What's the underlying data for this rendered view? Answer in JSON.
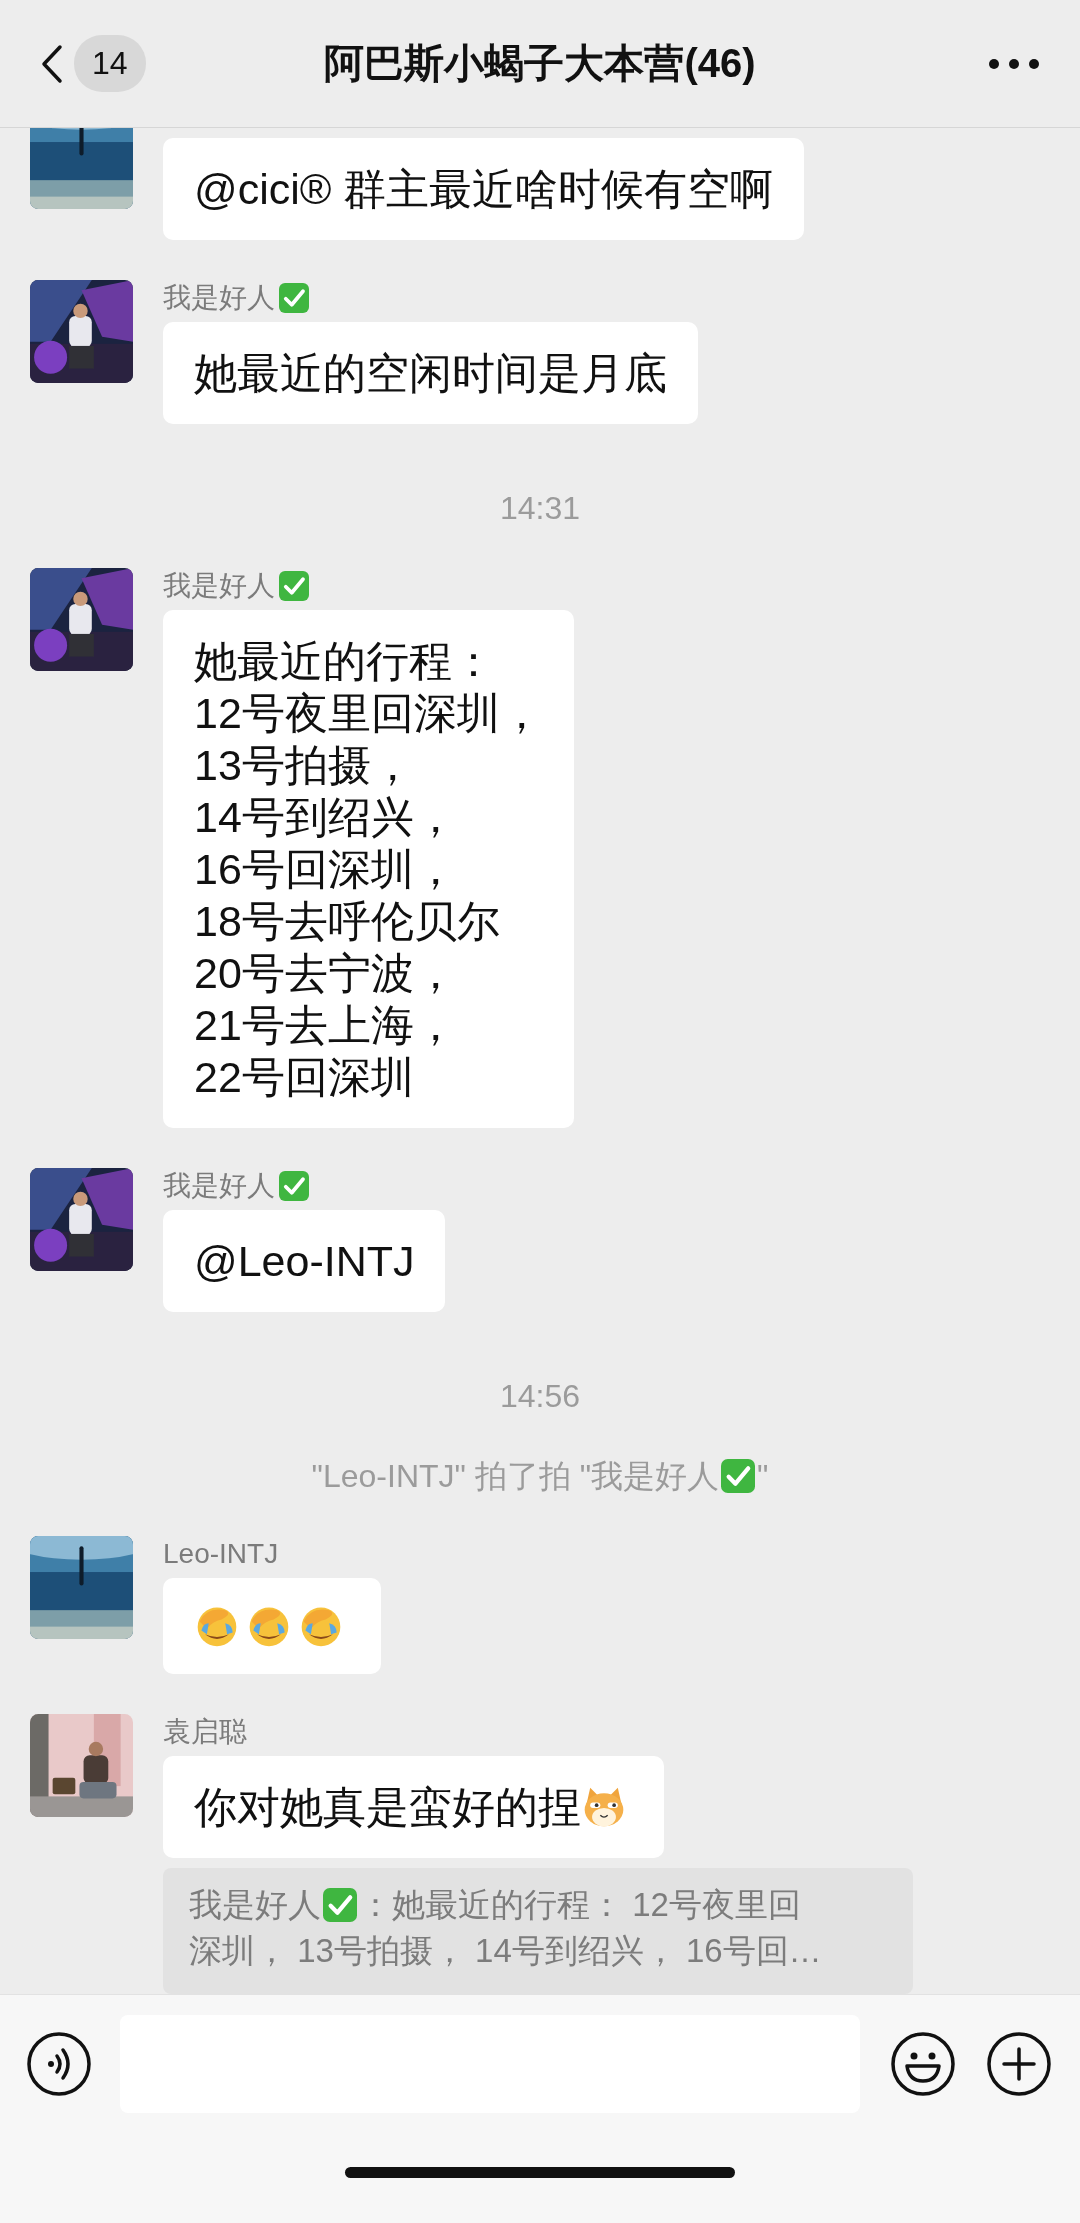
{
  "header": {
    "back_count": "14",
    "title": "阿巴斯小蝎子大本营(46)"
  },
  "items": [
    {
      "kind": "message",
      "parts": [
        {
          "kind": "text",
          "text": "@cici® 群主最近啥时候有空啊"
        }
      ]
    },
    {
      "kind": "message",
      "sender": "我是好人",
      "sender_verified": true,
      "parts": [
        {
          "kind": "text",
          "text": "她最近的空闲时间是月底"
        }
      ]
    },
    {
      "kind": "time",
      "text": "14:31"
    },
    {
      "kind": "message",
      "sender": "我是好人",
      "sender_verified": true,
      "parts": [
        {
          "kind": "text",
          "text": "她最近的行程：\n12号夜里回深圳，\n13号拍摄，\n14号到绍兴，\n16号回深圳，\n18号去呼伦贝尔\n20号去宁波，\n21号去上海，\n22号回深圳"
        }
      ]
    },
    {
      "kind": "message",
      "sender": "我是好人",
      "sender_verified": true,
      "parts": [
        {
          "kind": "text",
          "text": "@Leo-INTJ"
        }
      ]
    },
    {
      "kind": "time",
      "text": "14:56"
    },
    {
      "kind": "system",
      "parts": [
        {
          "kind": "text",
          "text": "\"Leo-INTJ\" 拍了拍 \"我是好人"
        },
        {
          "kind": "check"
        },
        {
          "kind": "text",
          "text": "\""
        }
      ]
    },
    {
      "kind": "message",
      "sender": "Leo-INTJ",
      "parts": [
        {
          "kind": "facepalm"
        },
        {
          "kind": "facepalm"
        },
        {
          "kind": "facepalm"
        }
      ]
    },
    {
      "kind": "message",
      "sender": "袁启聪",
      "parts": [
        {
          "kind": "text",
          "text": "你对她真是蛮好的捏"
        },
        {
          "kind": "cat"
        }
      ],
      "quote": {
        "author": "我是好人",
        "author_verified": true,
        "lines": [
          "：她最近的行程： 12号夜里回",
          "深圳， 13号拍摄， 14号到绍兴， 16号回…"
        ]
      }
    }
  ]
}
